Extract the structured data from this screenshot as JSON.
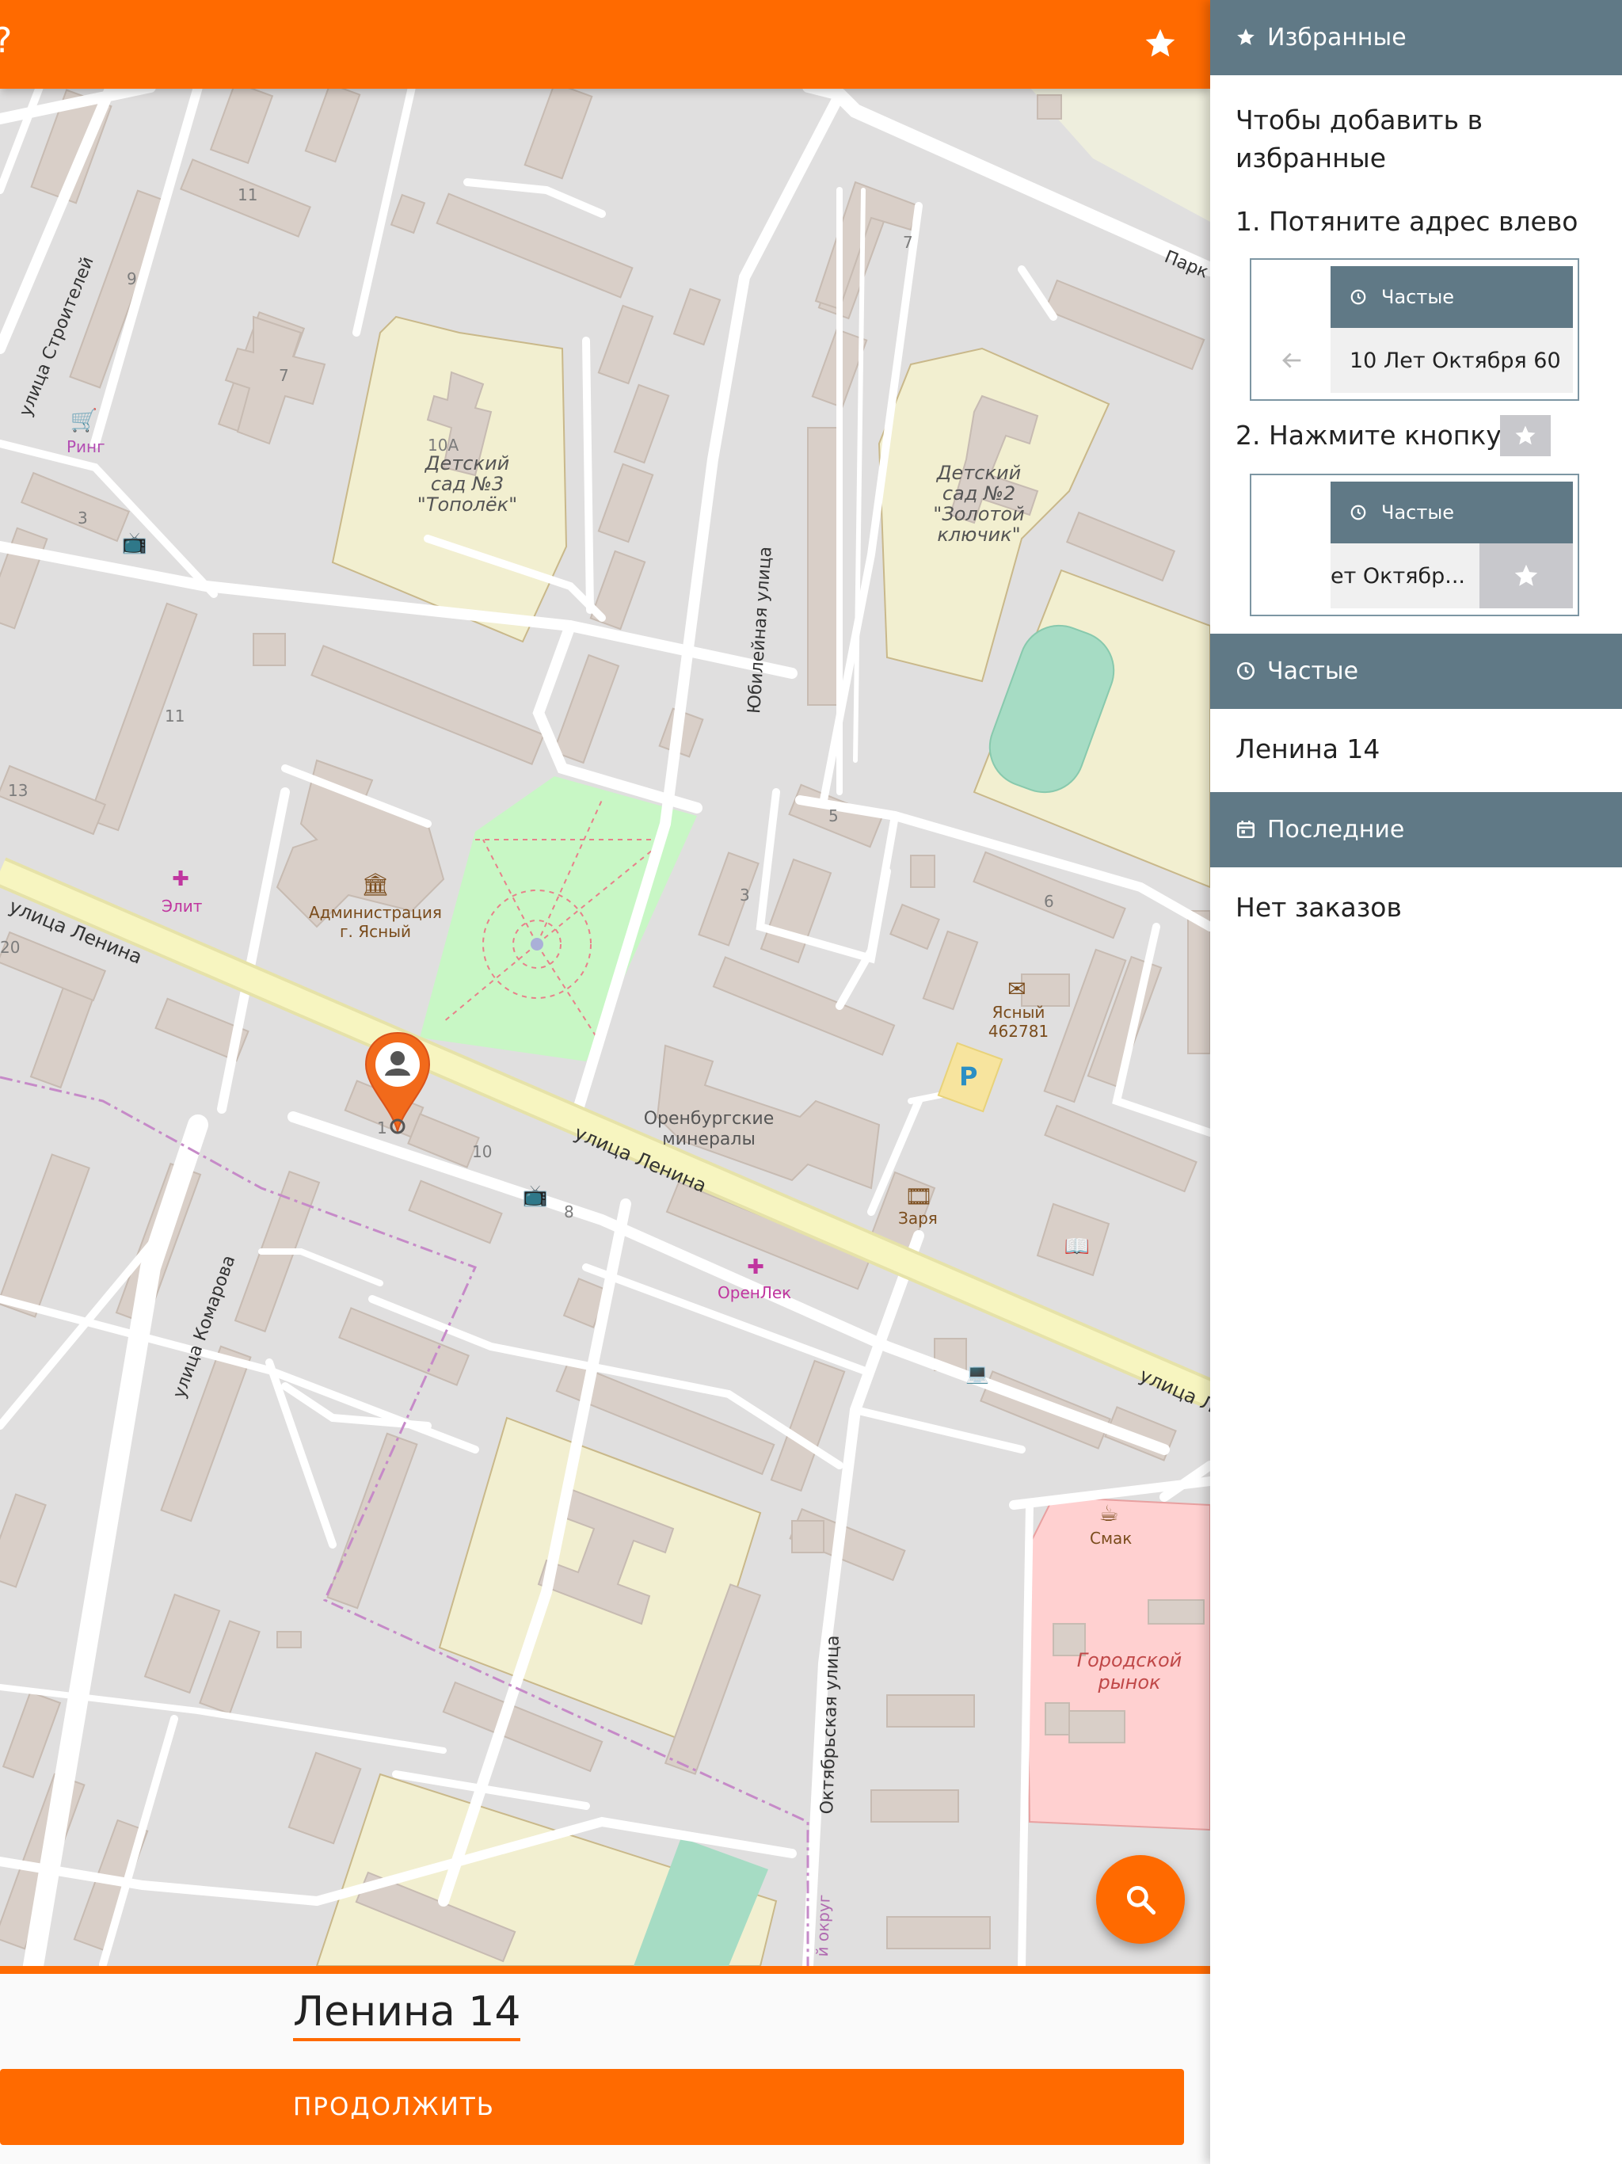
{
  "topbar": {
    "title": "?",
    "favorite_icon": "star-icon"
  },
  "map": {
    "streets": {
      "lenina_left": "улица Ленина",
      "lenina_mid": "улица Ленина",
      "lenina_right": "улица Ле",
      "stroiteley": "улица Строителей",
      "yubileynaya": "Юбилейная улица",
      "komarova": "улица Комарова",
      "oktyabrskaya": "Октябрьская улица",
      "park": "Парк",
      "okrug": "й округ"
    },
    "pois": {
      "ring": "Ринг",
      "kindergarten3": [
        "Детский",
        "сад №3",
        "\"Тополёк\""
      ],
      "kindergarten3_num": "10А",
      "kindergarten2": [
        "Детский",
        "сад №2",
        "\"Золотой",
        "ключик\""
      ],
      "elit": "Элит",
      "admin": [
        "Администрация",
        "г. Ясный"
      ],
      "post": [
        "Ясный",
        "462781"
      ],
      "minerals": [
        "Оренбургские",
        "минералы"
      ],
      "zarya": "Заря",
      "orenlek": "ОренЛек",
      "smak": "Смак",
      "market": [
        "Городской",
        "рынок"
      ],
      "parking": "P"
    },
    "house_numbers": [
      "11",
      "9",
      "7",
      "3",
      "11",
      "13",
      "20",
      "7",
      "5",
      "3",
      "6",
      "10",
      "8",
      "1"
    ]
  },
  "fab": {
    "icon": "search-icon"
  },
  "bottom": {
    "address": "Ленина 14",
    "continue_label": "ПРОДОЛЖИТЬ"
  },
  "sidebar": {
    "favorites": {
      "header": "Избранные",
      "intro": [
        "Чтобы добавить в",
        "избранные"
      ],
      "step1": "1. Потяните адрес влево",
      "step2": "2. Нажмите кнопку",
      "demo1": {
        "header": "Частые",
        "row": "10 Лет Октября 60"
      },
      "demo2": {
        "header": "Частые",
        "row": "ет Октябр..."
      }
    },
    "frequent": {
      "header": "Частые",
      "items": [
        "Ленина 14"
      ]
    },
    "recent": {
      "header": "Последние",
      "empty": "Нет заказов"
    }
  },
  "colors": {
    "accent": "#ff6a00",
    "section_header": "#607986",
    "map_bg": "#e0dfdf"
  }
}
